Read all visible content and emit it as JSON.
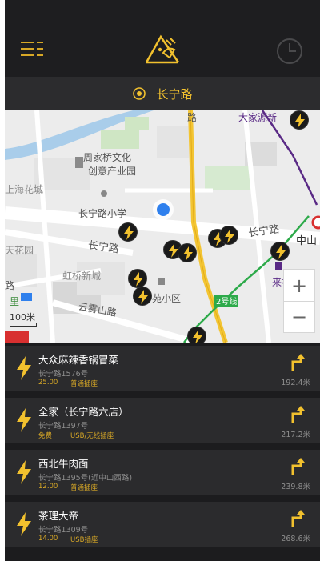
{
  "header": {
    "menu_icon": "menu-list-icon",
    "logo_icon": "mountain-plug-logo",
    "history_icon": "clock-icon"
  },
  "location": {
    "icon": "target-icon",
    "name": "长宁路"
  },
  "map": {
    "labels": {
      "zhoujiaqiao": "周家桥文化",
      "chuangyi": "创意产业园",
      "shanghaihuacheng": "上海花城",
      "changninglu_school": "长宁路小学",
      "road_changning_left": "长宁路",
      "road_changning_right": "长宁路",
      "tianhuayuan": "天花园",
      "hongqiaoxincheng": "虹桥新城",
      "yunwushanlu": "云雾山路",
      "yuanxiaoqu": "苑小区",
      "lishi": "里",
      "zhongshan": "中山",
      "laifushi": "来福士",
      "dajiayuan": "大家源新",
      "line2": "2号线",
      "road_top": "路",
      "road_left_edge": "路"
    },
    "scale": "100米",
    "zoom_in": "+",
    "zoom_out": "−"
  },
  "stations": [
    {
      "name": "大众麻辣香锅冒菜",
      "address": "长宁路1576号",
      "price": "25.00",
      "type": "普通插座",
      "distance": "192.4米"
    },
    {
      "name": "全家（长宁路六店）",
      "address": "长宁路1397号",
      "price": "免费",
      "type": "USB/无线插座",
      "distance": "217.2米"
    },
    {
      "name": "西北牛肉面",
      "address": "长宁路1395号(近中山西路)",
      "price": "12.00",
      "type": "普通插座",
      "distance": "239.8米"
    },
    {
      "name": "茶理大帝",
      "address": "长宁路1309号",
      "price": "14.00",
      "type": "USB插座",
      "distance": "268.6米"
    }
  ],
  "colors": {
    "accent": "#f2c12e",
    "header_bg": "#1e1e20",
    "item_bg": "#2b2b2d",
    "metro_line2": "#2daa4a",
    "metro_purple": "#5a2a86"
  }
}
